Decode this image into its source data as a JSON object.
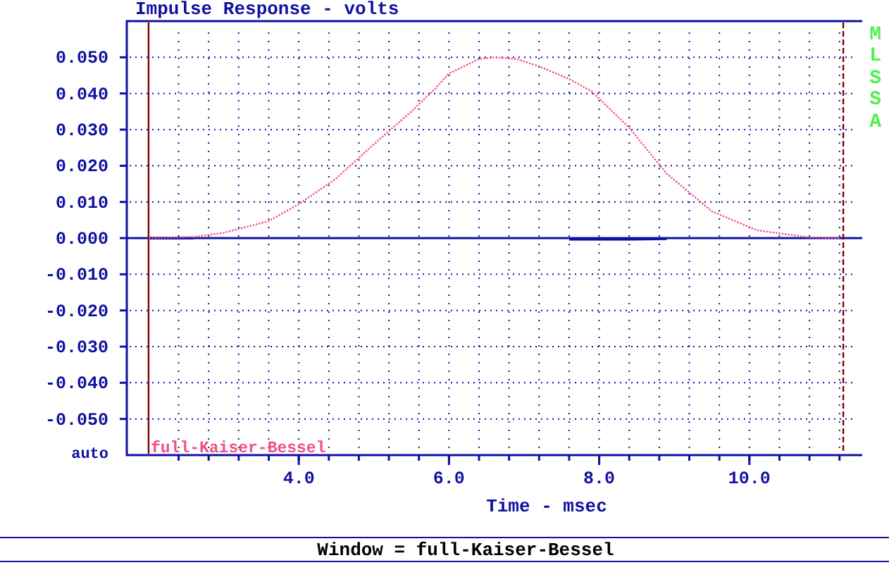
{
  "title": "Impulse Response - volts",
  "brand": "MLSSA",
  "chart": {
    "chart_data": {
      "type": "line",
      "xlabel": "Time - msec",
      "xlim": [
        1.71,
        11.54
      ],
      "ylim": [
        -0.06,
        0.06
      ],
      "x": [
        2.0,
        2.6,
        3.0,
        3.6,
        4.0,
        4.5,
        5.0,
        5.5,
        5.8,
        6.0,
        6.4,
        6.6,
        6.9,
        7.2,
        7.6,
        7.9,
        8.4,
        8.9,
        9.5,
        10.1,
        10.8,
        11.2
      ],
      "series": [
        {
          "name": "full-Kaiser-Bessel",
          "color": "#f05088",
          "line_style": "dotted",
          "values": [
            0,
            0.0003,
            0.0015,
            0.0047,
            0.0094,
            0.0165,
            0.026,
            0.035,
            0.041,
            0.0455,
            0.0495,
            0.05,
            0.0495,
            0.0475,
            0.044,
            0.0406,
            0.0305,
            0.0178,
            0.0074,
            0.0022,
            0.0002,
            0
          ]
        },
        {
          "color": "#1010a0",
          "values": [
            0,
            0,
            null,
            null,
            null,
            null,
            null,
            null,
            null,
            null,
            null,
            null,
            null,
            null,
            -0.0003,
            -0.0003,
            -0.0003,
            -0.0002,
            null,
            null,
            null,
            null
          ]
        }
      ],
      "xticks": [
        {
          "value": 4,
          "label": "4.0"
        },
        {
          "value": 6,
          "label": "6.0"
        },
        {
          "value": 8,
          "label": "8.0"
        },
        {
          "value": 10,
          "label": "10.0"
        }
      ],
      "yticks": [
        {
          "value": 0.05,
          "label": "0.050"
        },
        {
          "value": 0.04,
          "label": "0.040"
        },
        {
          "value": 0.03,
          "label": "0.030"
        },
        {
          "value": 0.02,
          "label": "0.020"
        },
        {
          "value": 0.01,
          "label": "0.010"
        },
        {
          "value": 0,
          "label": "0.000"
        },
        {
          "value": -0.01,
          "label": "-0.010"
        },
        {
          "value": -0.02,
          "label": "-0.020"
        },
        {
          "value": -0.03,
          "label": "-0.030"
        },
        {
          "value": -0.04,
          "label": "-0.040"
        },
        {
          "value": -0.05,
          "label": "-0.050"
        }
      ],
      "ref_lines": [
        {
          "axis": "x",
          "value": 2.0
        },
        {
          "axis": "x",
          "value": 11.25,
          "line_style": "dashed"
        },
        {
          "axis": "y",
          "value": 0
        }
      ],
      "grid": true
    },
    "scale_mode": "auto"
  },
  "status_bar": "Window = full-Kaiser-Bessel"
}
